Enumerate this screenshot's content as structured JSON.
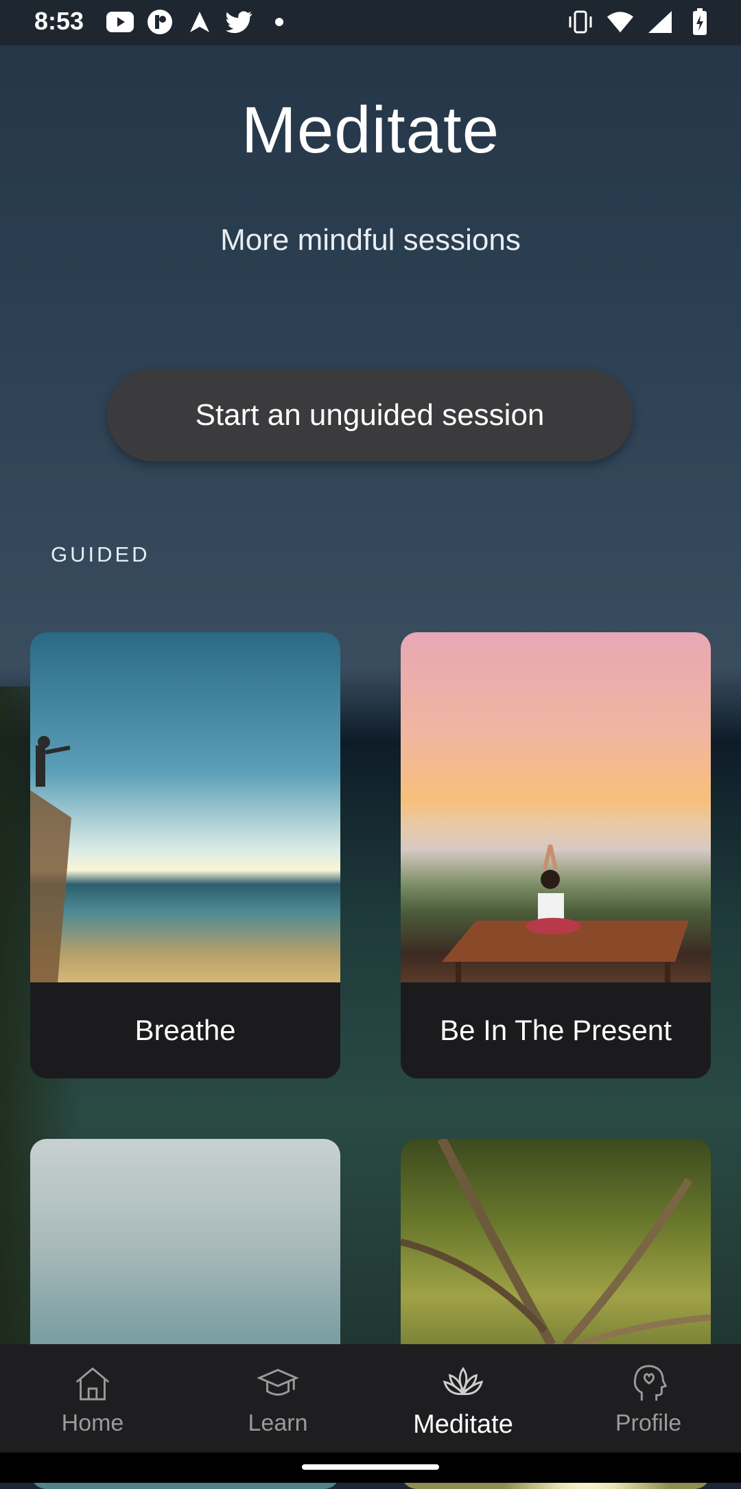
{
  "status_bar": {
    "time": "8:53",
    "left_icons": [
      "youtube-icon",
      "app-icon",
      "navigation-arrow-icon",
      "twitter-icon",
      "dot-icon"
    ],
    "right_icons": [
      "vibrate-icon",
      "wifi-icon",
      "signal-icon",
      "battery-charging-icon"
    ]
  },
  "header": {
    "title": "Meditate",
    "subtitle": "More mindful sessions"
  },
  "unguided_button": {
    "label": "Start an unguided session"
  },
  "guided": {
    "section_label": "GUIDED",
    "cards": [
      {
        "title": "Breathe"
      },
      {
        "title": "Be In The Present"
      },
      {
        "title": ""
      },
      {
        "title": ""
      }
    ]
  },
  "bottom_nav": {
    "items": [
      {
        "label": "Home",
        "icon": "home-icon",
        "active": false
      },
      {
        "label": "Learn",
        "icon": "graduation-cap-icon",
        "active": false
      },
      {
        "label": "Meditate",
        "icon": "lotus-icon",
        "active": true
      },
      {
        "label": "Profile",
        "icon": "head-heart-icon",
        "active": false
      }
    ]
  },
  "colors": {
    "button_bg": "#3b3b3d",
    "card_caption_bg": "#1b1b1d",
    "nav_bg": "#1e1e20",
    "nav_inactive": "#9b9b9b",
    "nav_active": "#ffffff"
  }
}
